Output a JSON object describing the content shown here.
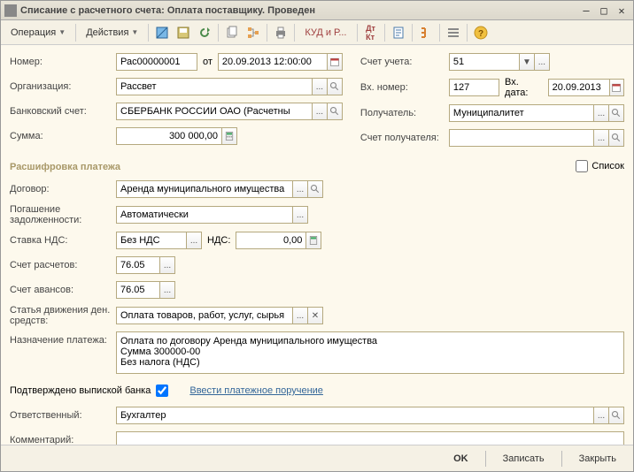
{
  "title": "Списание с расчетного счета: Оплата поставщику. Проведен",
  "toolbar": {
    "operation": "Операция",
    "actions": "Действия",
    "kudir": "КУД и Р..."
  },
  "left": {
    "number_label": "Номер:",
    "number": "Рас00000001",
    "from": "от",
    "date": "20.09.2013 12:00:00",
    "org_label": "Организация:",
    "org": "Рассвет",
    "bank_label": "Банковский счет:",
    "bank": "СБЕРБАНК РОССИИ ОАО (Расчетны",
    "sum_label": "Сумма:",
    "sum": "300 000,00"
  },
  "right": {
    "account_label": "Счет учета:",
    "account": "51",
    "in_number_label": "Вх. номер:",
    "in_number": "127",
    "in_date_label": "Вх. дата:",
    "in_date": "20.09.2013",
    "recipient_label": "Получатель:",
    "recipient": "Муниципалитет",
    "recipient_account_label": "Счет получателя:",
    "recipient_account": ""
  },
  "section_title": "Расшифровка платежа",
  "list_checkbox_label": "Список",
  "details": {
    "contract_label": "Договор:",
    "contract": "Аренда муниципального имущества",
    "debt_label": "Погашение задолженности:",
    "debt": "Автоматически",
    "vat_rate_label": "Ставка НДС:",
    "vat_rate": "Без НДС",
    "vat_label": "НДС:",
    "vat": "0,00",
    "settle_label": "Счет расчетов:",
    "settle": "76.05",
    "advance_label": "Счет авансов:",
    "advance": "76.05",
    "flow_label": "Статья движения ден. средств:",
    "flow": "Оплата товаров, работ, услуг, сырья",
    "purpose_label": "Назначение платежа:",
    "purpose": "Оплата по договору Аренда муниципального имущества\nСумма 300000-00\nБез налога (НДС)"
  },
  "bank_confirm_label": "Подтверждено выпиской банка",
  "payment_order_link": "Ввести платежное поручение",
  "responsible_label": "Ответственный:",
  "responsible": "Бухгалтер",
  "comment_label": "Комментарий:",
  "comment": "",
  "footer": {
    "ok": "OK",
    "save": "Записать",
    "close": "Закрыть"
  }
}
